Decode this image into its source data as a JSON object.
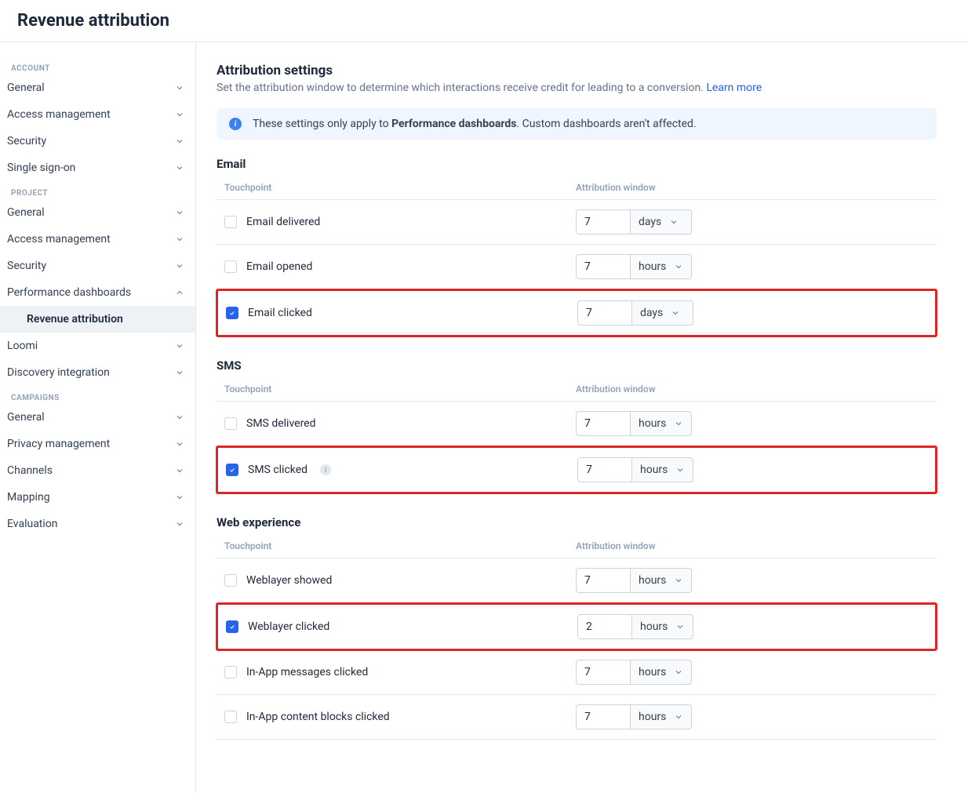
{
  "page_title": "Revenue attribution",
  "sidebar": {
    "groups": [
      {
        "label": "ACCOUNT",
        "items": [
          {
            "label": "General",
            "expanded": false
          },
          {
            "label": "Access management",
            "expanded": false
          },
          {
            "label": "Security",
            "expanded": false
          },
          {
            "label": "Single sign-on",
            "expanded": false
          }
        ]
      },
      {
        "label": "PROJECT",
        "items": [
          {
            "label": "General",
            "expanded": false
          },
          {
            "label": "Access management",
            "expanded": false
          },
          {
            "label": "Security",
            "expanded": false
          },
          {
            "label": "Performance dashboards",
            "expanded": true,
            "subitems": [
              {
                "label": "Revenue attribution",
                "active": true
              }
            ]
          },
          {
            "label": "Loomi",
            "expanded": false
          },
          {
            "label": "Discovery integration",
            "expanded": false
          }
        ]
      },
      {
        "label": "CAMPAIGNS",
        "items": [
          {
            "label": "General",
            "expanded": false
          },
          {
            "label": "Privacy management",
            "expanded": false
          },
          {
            "label": "Channels",
            "expanded": false
          },
          {
            "label": "Mapping",
            "expanded": false
          },
          {
            "label": "Evaluation",
            "expanded": false
          }
        ]
      }
    ]
  },
  "content": {
    "heading": "Attribution settings",
    "subtitle_pre": "Set the attribution window to determine which interactions receive credit for leading to a conversion. ",
    "learn_more": "Learn more",
    "banner_pre": "These settings only apply to ",
    "banner_bold": "Performance dashboards",
    "banner_post": ". Custom dashboards aren't affected.",
    "col_touchpoint": "Touchpoint",
    "col_window": "Attribution window",
    "sections": [
      {
        "name": "Email",
        "rows": [
          {
            "label": "Email delivered",
            "checked": false,
            "value": "7",
            "unit": "days",
            "highlighted": false,
            "info": false
          },
          {
            "label": "Email opened",
            "checked": false,
            "value": "7",
            "unit": "hours",
            "highlighted": false,
            "info": false
          },
          {
            "label": "Email clicked",
            "checked": true,
            "value": "7",
            "unit": "days",
            "highlighted": true,
            "info": false
          }
        ]
      },
      {
        "name": "SMS",
        "rows": [
          {
            "label": "SMS delivered",
            "checked": false,
            "value": "7",
            "unit": "hours",
            "highlighted": false,
            "info": false
          },
          {
            "label": "SMS clicked",
            "checked": true,
            "value": "7",
            "unit": "hours",
            "highlighted": true,
            "info": true
          }
        ]
      },
      {
        "name": "Web experience",
        "rows": [
          {
            "label": "Weblayer showed",
            "checked": false,
            "value": "7",
            "unit": "hours",
            "highlighted": false,
            "info": false
          },
          {
            "label": "Weblayer clicked",
            "checked": true,
            "value": "2",
            "unit": "hours",
            "highlighted": true,
            "info": false
          },
          {
            "label": "In-App messages clicked",
            "checked": false,
            "value": "7",
            "unit": "hours",
            "highlighted": false,
            "info": false
          },
          {
            "label": "In-App content blocks clicked",
            "checked": false,
            "value": "7",
            "unit": "hours",
            "highlighted": false,
            "info": false
          }
        ]
      }
    ]
  }
}
